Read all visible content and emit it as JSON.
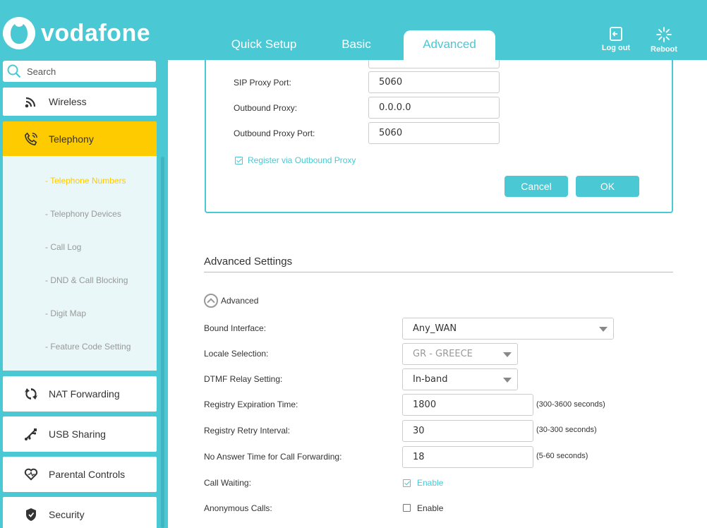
{
  "brand": {
    "name": "vodafone"
  },
  "header": {
    "tabs": [
      {
        "label": "Quick Setup"
      },
      {
        "label": "Basic"
      },
      {
        "label": "Advanced"
      }
    ],
    "logout_label": "Log out",
    "reboot_label": "Reboot"
  },
  "search": {
    "placeholder": "Search"
  },
  "sidebar": {
    "items": [
      {
        "label": "Wireless",
        "icon": "wireless-icon"
      },
      {
        "label": "Telephony",
        "icon": "telephony-icon"
      },
      {
        "label": "NAT Forwarding",
        "icon": "nat-forwarding-icon"
      },
      {
        "label": "USB Sharing",
        "icon": "usb-icon"
      },
      {
        "label": "Parental Controls",
        "icon": "heart-icon"
      },
      {
        "label": "Security",
        "icon": "shield-icon"
      }
    ],
    "sub_items": [
      {
        "label": "- Telephone Numbers"
      },
      {
        "label": "- Telephony Devices"
      },
      {
        "label": "- Call Log"
      },
      {
        "label": "- DND & Call Blocking"
      },
      {
        "label": "- Digit Map"
      },
      {
        "label": "- Feature Code Setting"
      }
    ]
  },
  "proxy_panel": {
    "sip_proxy_port": {
      "label": "SIP Proxy Port:",
      "value": "5060"
    },
    "outbound_proxy": {
      "label": "Outbound Proxy:",
      "value": "0.0.0.0"
    },
    "outbound_proxy_port": {
      "label": "Outbound Proxy Port:",
      "value": "5060"
    },
    "register_via_outbound": {
      "label": "Register via Outbound Proxy",
      "checked": true
    },
    "cancel_label": "Cancel",
    "ok_label": "OK"
  },
  "advanced_settings": {
    "title": "Advanced Settings",
    "toggle_label": "Advanced",
    "bound_interface": {
      "label": "Bound Interface:",
      "value": "Any_WAN"
    },
    "locale_selection": {
      "label": "Locale Selection:",
      "value": "GR - GREECE"
    },
    "dtmf_relay": {
      "label": "DTMF Relay Setting:",
      "value": "In-band"
    },
    "registry_expiration": {
      "label": "Registry Expiration Time:",
      "value": "1800",
      "hint": "(300-3600 seconds)"
    },
    "registry_retry": {
      "label": "Registry Retry Interval:",
      "value": "30",
      "hint": "(30-300 seconds)"
    },
    "no_answer_time": {
      "label": "No Answer Time for Call Forwarding:",
      "value": "18",
      "hint": "(5-60 seconds)"
    },
    "call_waiting": {
      "label": "Call Waiting:",
      "option": "Enable",
      "checked": true
    },
    "anonymous_calls": {
      "label": "Anonymous Calls:",
      "option": "Enable",
      "checked": false
    }
  },
  "colors": {
    "brand_teal": "#4ac8d4",
    "active_yellow": "#fecb00"
  }
}
